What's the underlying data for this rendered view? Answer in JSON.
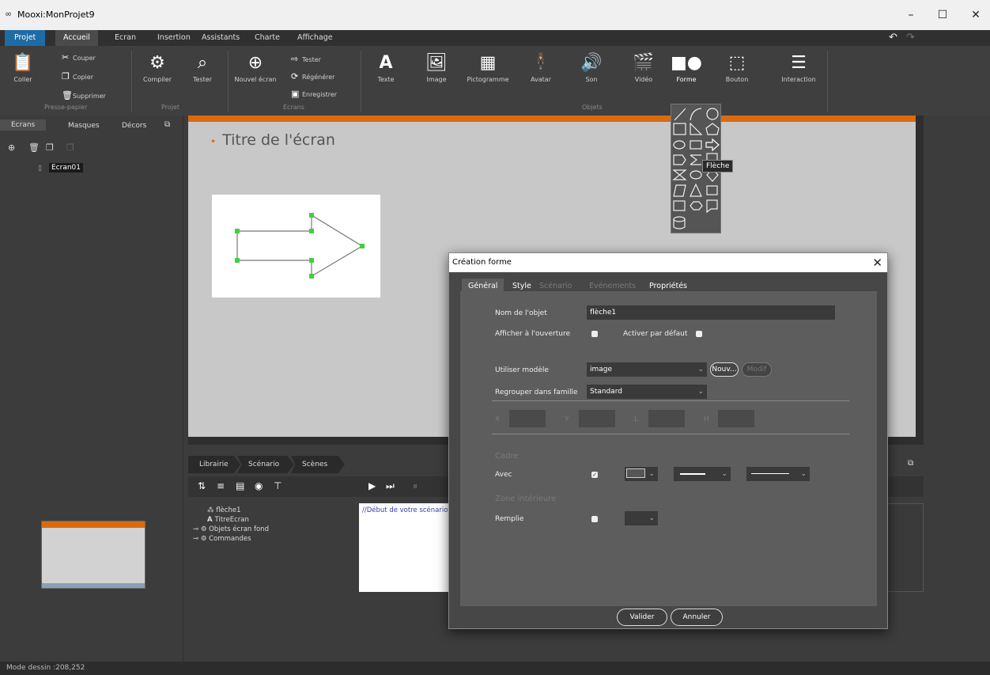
{
  "window": {
    "title": "Mooxi:MonProjet9",
    "min": "–",
    "max": "☐",
    "close": "✕"
  },
  "menu": {
    "tabs": [
      "Projet",
      "Accueil",
      "Ecran",
      "Insertion",
      "Assistants",
      "Charte",
      "Affichage"
    ]
  },
  "ribbon": {
    "clipboard": {
      "paste": "Coller",
      "cut": "Couper",
      "copy": "Copier",
      "delete": "Supprimer",
      "group": "Presse-papier"
    },
    "project": {
      "compile": "Compiler",
      "test": "Tester",
      "group": "Projet"
    },
    "screens": {
      "new": "Nouvel écran",
      "test": "Tester",
      "regen": "Régénérer",
      "save": "Enregistrer",
      "group": "Ecrans"
    },
    "objects": {
      "items": [
        "Texte",
        "Image",
        "Pictogramme",
        "Avatar",
        "Son",
        "Vidéo",
        "Forme",
        "Bouton",
        "Interaction"
      ],
      "group": "Objets"
    }
  },
  "leftpanel": {
    "tabs": [
      "Ecrans",
      "Masques",
      "Décors"
    ],
    "screen_item": "Ecran01"
  },
  "canvas": {
    "title": "Titre de l'écran"
  },
  "lower": {
    "crumbs": [
      "Librairie",
      "Scénario",
      "Scènes"
    ],
    "tree": [
      "flèche1",
      "TitreEcran",
      "Objets écran fond",
      "Commandes"
    ],
    "scenario_text": "//Début de votre scénario"
  },
  "tooltip": "Flèche",
  "dialog": {
    "title": "Création forme",
    "tabs": [
      "Général",
      "Style",
      "Scénario",
      "Evénements",
      "Propriétés"
    ],
    "name_label": "Nom de l'objet",
    "name_value": "flèche1",
    "show_label": "Afficher à l'ouverture",
    "activate_label": "Activer par défaut",
    "model_label": "Utiliser modèle",
    "model_value": "image",
    "new_btn": "Nouv...",
    "modif_btn": "Modif",
    "group_label": "Regrouper dans famille",
    "group_value": "Standard",
    "coords": [
      "X",
      "Y",
      "L",
      "H"
    ],
    "frame_title": "Cadre",
    "frame_with": "Avec",
    "inner_title": "Zone intérieure",
    "inner_fill": "Remplie",
    "ok": "Valider",
    "cancel": "Annuler"
  },
  "status": "Mode dessin :208,252"
}
